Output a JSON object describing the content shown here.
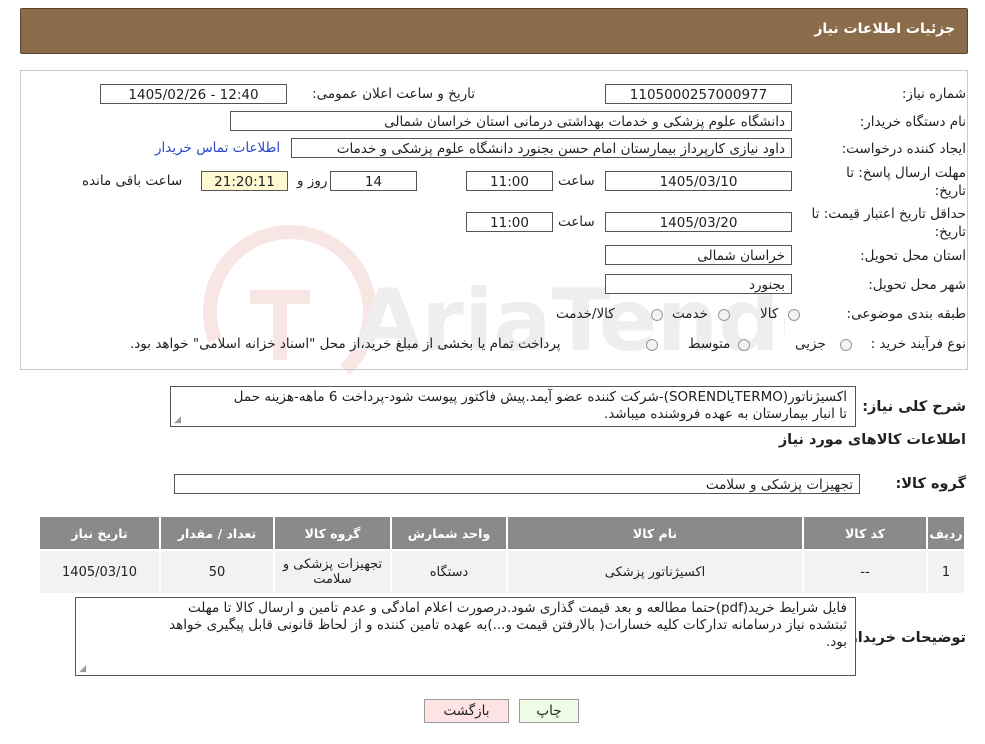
{
  "header": {
    "title": "جزئیات اطلاعات نیاز"
  },
  "watermark": {
    "text": "AriaTender.neT"
  },
  "form": {
    "need_number_label": "شماره نیاز:",
    "need_number": "1105000257000977",
    "announce_label": "تاریخ و ساعت اعلان عمومی:",
    "announce_value": "1405/02/26 - 12:40",
    "buyer_org_label": "نام دستگاه خریدار:",
    "buyer_org": "دانشگاه علوم پزشکی و خدمات بهداشتی درمانی استان خراسان شمالی",
    "creator_label": "ایجاد کننده درخواست:",
    "creator": "داود نیازی کارپرداز بیمارستان امام حسن بجنورد دانشگاه علوم پزشکی و خدمات",
    "contact_link": "اطلاعات تماس خریدار",
    "deadline_label_1": "مهلت ارسال پاسخ: تا",
    "deadline_label_2": "تاریخ:",
    "deadline_date": "1405/03/10",
    "time_label": "ساعت",
    "deadline_time": "11:00",
    "days_value": "14",
    "days_label": "روز و",
    "remaining_time": "21:20:11",
    "remaining_label": "ساعت باقی مانده",
    "validity_label_1": "حداقل تاریخ اعتبار قیمت: تا",
    "validity_label_2": "تاریخ:",
    "validity_date": "1405/03/20",
    "validity_time": "11:00",
    "province_label": "استان محل تحویل:",
    "province": "خراسان شمالی",
    "city_label": "شهر محل تحویل:",
    "city": "بجنورد",
    "category_label": "طبقه بندی موضوعی:",
    "category_options": [
      "کالا",
      "خدمت",
      "کالا/خدمت"
    ],
    "process_label": "نوع فرآیند خرید :",
    "process_options": [
      "جزیی",
      "متوسط"
    ],
    "process_note": "پرداخت تمام یا بخشی از مبلغ خرید،از محل \"اسناد خزانه اسلامی\" خواهد بود."
  },
  "description": {
    "label": "شرح کلی نیاز:",
    "line1": "اکسیژناتور(TERMOیاSOREND)-شرکت کننده عضو آیمد.پیش فاکتور پیوست  شود-پرداخت 6 ماهه-هزینه حمل",
    "line2": "تا انبار بیمارستان به عهده فروشنده میباشد."
  },
  "goods": {
    "title": "اطلاعات کالاهای مورد نیاز",
    "group_label": "گروه کالا:",
    "group_value": "تجهیزات پزشکی و سلامت"
  },
  "table": {
    "headers": [
      "ردیف",
      "کد کالا",
      "نام کالا",
      "واحد شمارش",
      "گروه کالا",
      "تعداد / مقدار",
      "تاریخ نیاز"
    ],
    "rows": [
      [
        "1",
        "--",
        "اکسیژناتور پزشکی",
        "دستگاه",
        "تجهیزات پزشکی و سلامت",
        "50",
        "1405/03/10"
      ]
    ]
  },
  "buyer_notes": {
    "label": "توضیحات خریدار:",
    "line1": "فایل شرایط خرید(pdf)حتما مطالعه و بعد قیمت گذاری شود.درصورت اعلام امادگی و عدم تامین و ارسال کالا تا مهلت",
    "line2": "ثبتشده نیاز درسامانه تدارکات کلیه خسارات( بالارفتن قیمت و...)به عهده تامین کننده و از لحاظ قانونی قابل پیگیری خواهد",
    "line3": "بود."
  },
  "buttons": {
    "print": "چاپ",
    "back": "بازگشت"
  },
  "colors": {
    "header_bg": "#8a6c4a",
    "table_header_bg": "#8a8a8a",
    "link": "#2a45c7",
    "print_bg": "#eefbe6",
    "back_bg": "#fde3e3"
  }
}
